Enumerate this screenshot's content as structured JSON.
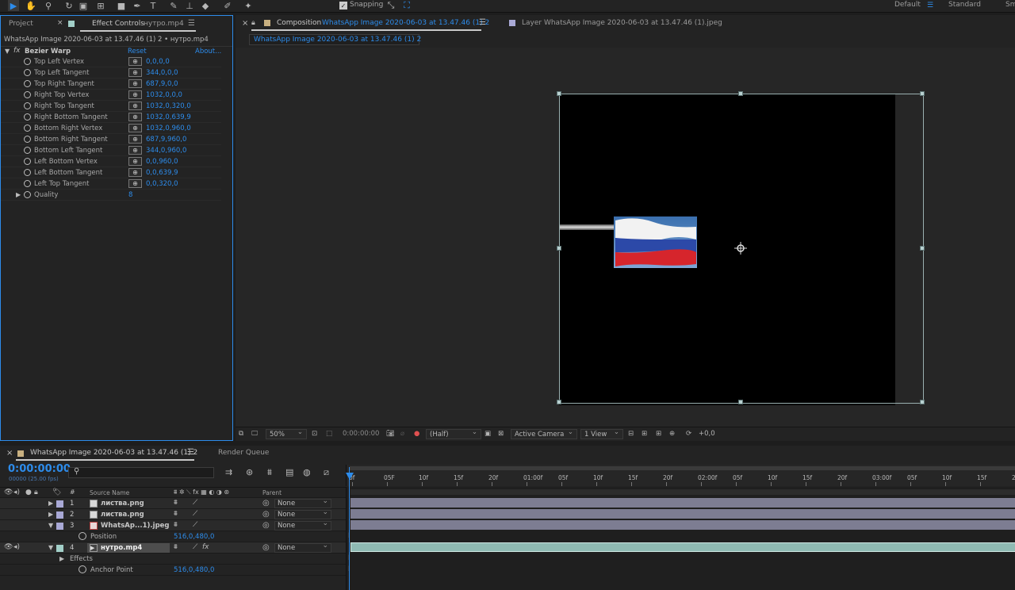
{
  "toolbar": {
    "snapping_label": "Snapping",
    "workspaces": [
      "Default",
      "Standard",
      "Sm"
    ]
  },
  "effect_controls": {
    "tab_project": "Project",
    "tab_effect_controls": "Effect Controls",
    "tab_effect_layer": "нутро.mp4",
    "breadcrumb": "WhatsApp Image 2020-06-03 at 13.47.46 (1) 2 • нутро.mp4",
    "effect_name": "Bezier Warp",
    "reset_label": "Reset",
    "about_label": "About...",
    "properties": [
      {
        "label": "Top Left Vertex",
        "value": "0,0,0,0"
      },
      {
        "label": "Top Left Tangent",
        "value": "344,0,0,0"
      },
      {
        "label": "Top Right Tangent",
        "value": "687,9,0,0"
      },
      {
        "label": "Right Top Vertex",
        "value": "1032,0,0,0"
      },
      {
        "label": "Right Top Tangent",
        "value": "1032,0,320,0"
      },
      {
        "label": "Right Bottom Tangent",
        "value": "1032,0,639,9"
      },
      {
        "label": "Bottom Right Vertex",
        "value": "1032,0,960,0"
      },
      {
        "label": "Bottom Right Tangent",
        "value": "687,9,960,0"
      },
      {
        "label": "Bottom Left Tangent",
        "value": "344,0,960,0"
      },
      {
        "label": "Left Bottom Vertex",
        "value": "0,0,960,0"
      },
      {
        "label": "Left Bottom Tangent",
        "value": "0,0,639,9"
      },
      {
        "label": "Left Top Tangent",
        "value": "0,0,320,0"
      }
    ],
    "quality_label": "Quality",
    "quality_value": "8"
  },
  "composition": {
    "tab_prefix": "Composition",
    "tab_name": "WhatsApp Image 2020-06-03 at 13.47.46 (1) 2",
    "layer_tab": "Layer  WhatsApp Image 2020-06-03 at 13.47.46 (1).jpeg",
    "sub_tab": "WhatsApp Image 2020-06-03 at 13.47.46 (1) 2"
  },
  "viewer_bar": {
    "zoom": "50%",
    "timecode": "0:00:00:00",
    "resolution": "(Half)",
    "camera": "Active Camera",
    "views": "1 View",
    "exposure": "+0,0"
  },
  "timeline": {
    "tab_name": "WhatsApp Image 2020-06-03 at 13.47.46 (1) 2",
    "render_queue": "Render Queue",
    "current_time": "0:00:00:00",
    "frame_info": "00000 (25.00 fps)",
    "col_source": "Source Name",
    "col_parent": "Parent",
    "col_num": "#",
    "layers": [
      {
        "num": "1",
        "name": "листва.png",
        "parent": "None",
        "color": "#a9a9d6"
      },
      {
        "num": "2",
        "name": "листва.png",
        "parent": "None",
        "color": "#a9a9d6"
      },
      {
        "num": "3",
        "name": "WhatsAp...1).jpeg",
        "parent": "None",
        "color": "#a9a9d6"
      },
      {
        "num": "4",
        "name": "нутро.mp4",
        "parent": "None",
        "color": "#a2cfc8"
      }
    ],
    "position_label": "Position",
    "position_value": "516,0,480,0",
    "effects_label": "Effects",
    "anchor_label": "Anchor Point",
    "anchor_value": "516,0,480,0",
    "ruler": [
      "0f",
      "05F",
      "10f",
      "15f",
      "20f",
      "01:00f",
      "05f",
      "10f",
      "15f",
      "20f",
      "02:00f",
      "05f",
      "10f",
      "15f",
      "20f",
      "03:00f",
      "05f",
      "10f",
      "15f",
      "2"
    ]
  }
}
